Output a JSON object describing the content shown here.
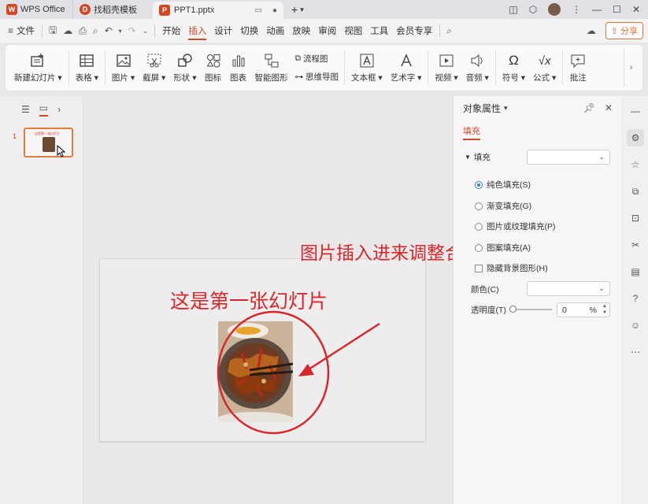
{
  "titlebar": {
    "app_name": "WPS Office",
    "tab_template": "找稻壳模板",
    "tab_file": "PPT1.pptx",
    "new_tab": "+"
  },
  "menubar": {
    "file": "文件",
    "items": [
      "开始",
      "插入",
      "设计",
      "切换",
      "动画",
      "放映",
      "审阅",
      "视图",
      "工具",
      "会员专享"
    ],
    "active_item": "插入",
    "share": "分享"
  },
  "ribbon": {
    "new_slide": "新建幻灯片",
    "table": "表格",
    "picture": "图片",
    "screenshot": "截屏",
    "shape": "形状",
    "icon": "图标",
    "chart": "图表",
    "smartart": "智能图形",
    "flowchart": "流程图",
    "mindmap": "思维导图",
    "textbox": "文本框",
    "wordart": "艺术字",
    "video": "视频",
    "audio": "音频",
    "symbol": "符号",
    "formula": "公式",
    "comment": "批注"
  },
  "slides_panel": {
    "slide_number": "1",
    "thumb_title": "这是第一张幻灯片"
  },
  "slide": {
    "title": "这是第一张幻灯片",
    "annotation": "图片插入进来调整合适大小"
  },
  "properties": {
    "header": "对象属性",
    "tab": "填充",
    "fill_label": "填充",
    "options": [
      "纯色填充(S)",
      "渐变填充(G)",
      "图片或纹理填充(P)",
      "图案填充(A)"
    ],
    "selected_option": "纯色填充(S)",
    "hide_bg": "隐藏背景图形(H)",
    "color_label": "颜色(C)",
    "transparency_label": "透明度(T)",
    "transparency_value": "0",
    "transparency_unit": "%"
  },
  "colors": {
    "accent": "#d24726",
    "annotation_red": "#d9262a",
    "radio_blue": "#3a7bd5"
  }
}
